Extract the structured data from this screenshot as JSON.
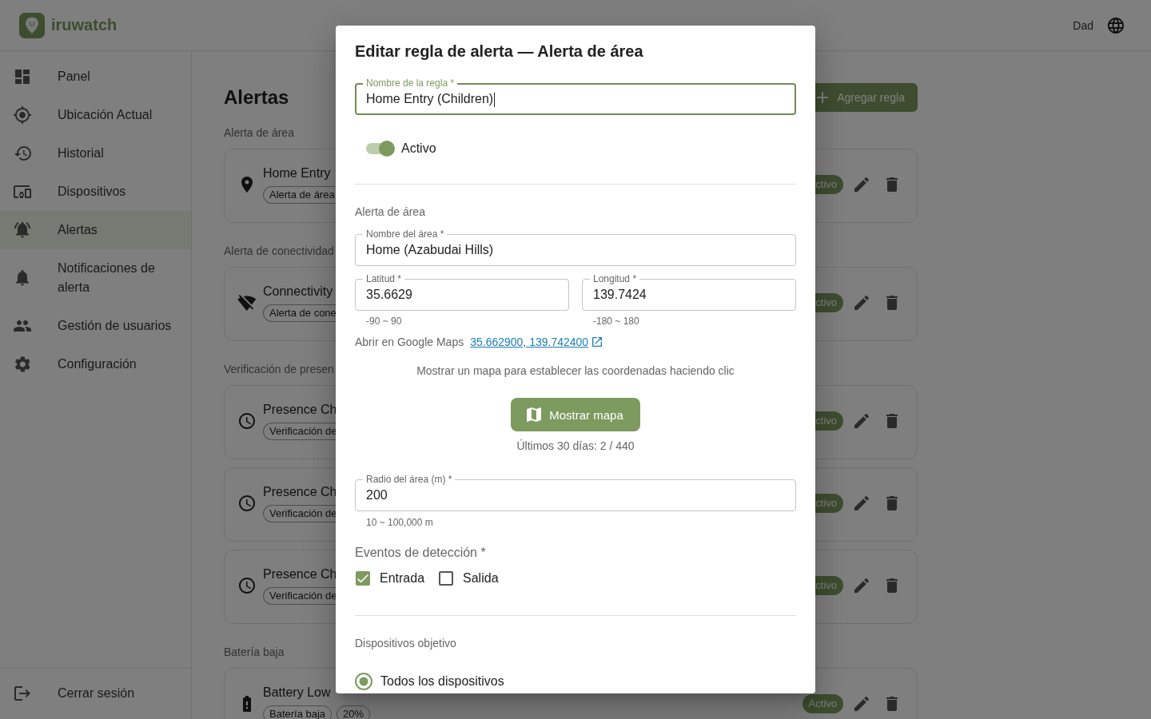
{
  "header": {
    "app_name": "iruwatch",
    "user": "Dad"
  },
  "sidebar": {
    "items": [
      {
        "label": "Panel",
        "selected": false
      },
      {
        "label": "Ubicación Actual",
        "selected": false
      },
      {
        "label": "Historial",
        "selected": false
      },
      {
        "label": "Dispositivos",
        "selected": false
      },
      {
        "label": "Alertas",
        "selected": true
      },
      {
        "label": "Notificaciones de alerta",
        "selected": false
      },
      {
        "label": "Gestión de usuarios",
        "selected": false
      },
      {
        "label": "Configuración",
        "selected": false
      }
    ],
    "logout": "Cerrar sesión"
  },
  "page": {
    "title": "Alertas",
    "add_button": "Agregar regla",
    "sections": [
      {
        "kind": "area",
        "label": "Alerta de área",
        "rules": [
          {
            "title": "Home Entry",
            "chips": [
              {
                "label": "Alerta de área",
                "clipped": true
              }
            ],
            "status": {
              "label": "ctivo",
              "active": true,
              "clipped": true
            }
          }
        ]
      },
      {
        "kind": "connectivity",
        "label": "Alerta de conectividad",
        "rules": [
          {
            "title": "Connectivity",
            "chips": [
              {
                "label": "Alerta de cone",
                "clipped": true
              }
            ],
            "status": {
              "label": "ctivo",
              "active": true,
              "clipped": true
            }
          }
        ]
      },
      {
        "kind": "presence",
        "label": "Verificación de presen",
        "rules": [
          {
            "title": "Presence Ch",
            "chips": [
              {
                "label": "Verificación de",
                "clipped": true
              }
            ],
            "status": {
              "label": "ctivo",
              "active": true,
              "clipped": true
            }
          },
          {
            "title": "Presence Ch",
            "chips": [
              {
                "label": "Verificación de",
                "clipped": true
              }
            ],
            "status": {
              "label": "ctivo",
              "active": true,
              "clipped": true
            }
          },
          {
            "title": "Presence Ch",
            "chips": [
              {
                "label": "Verificación de",
                "clipped": true
              }
            ],
            "status": {
              "label": "ctivo",
              "active": true,
              "clipped": true
            }
          }
        ]
      },
      {
        "kind": "battery",
        "label": "Batería baja",
        "rules": [
          {
            "title": "Battery Low",
            "chips": [
              {
                "label": "Batería baja",
                "clipped": false
              },
              {
                "label": "20%",
                "clipped": false
              }
            ],
            "status": {
              "label": "Activo",
              "active": true,
              "clipped": false
            }
          }
        ]
      }
    ]
  },
  "dialog": {
    "title": "Editar regla de alerta — Alerta de área",
    "rule_name": {
      "label": "Nombre de la regla *",
      "value": "Home Entry (Children)",
      "focused": true
    },
    "enabled_switch": {
      "label": "Activo",
      "on": true
    },
    "area_section": {
      "heading": "Alerta de área",
      "area_name": {
        "label": "Nombre del área *",
        "value": "Home (Azabudai Hills)",
        "focused": false
      },
      "latitude": {
        "label": "Latitud *",
        "value": "35.6629",
        "focused": false,
        "helper": "-90 ~ 90"
      },
      "longitude": {
        "label": "Longitud *",
        "value": "139.7424",
        "focused": false,
        "helper": "-180 ~ 180"
      },
      "maps_link": {
        "label": "Abrir en Google Maps",
        "link": "35.662900, 139.742400"
      },
      "map_hint": "Mostrar un mapa para establecer las coordenadas haciendo clic",
      "map_button": "Mostrar mapa",
      "stats": "Últimos 30 días: 2 / 440",
      "radius": {
        "label": "Radio del área (m) *",
        "value": "200",
        "focused": false,
        "helper": "10 ~ 100,000 m"
      },
      "events": {
        "label": "Eventos de detección *",
        "options": [
          {
            "label": "Entrada",
            "checked": true
          },
          {
            "label": "Salida",
            "checked": false
          }
        ]
      }
    },
    "devices_section": {
      "heading": "Dispositivos objetivo",
      "options": [
        {
          "label": "Todos los dispositivos",
          "selected": true
        }
      ]
    }
  }
}
